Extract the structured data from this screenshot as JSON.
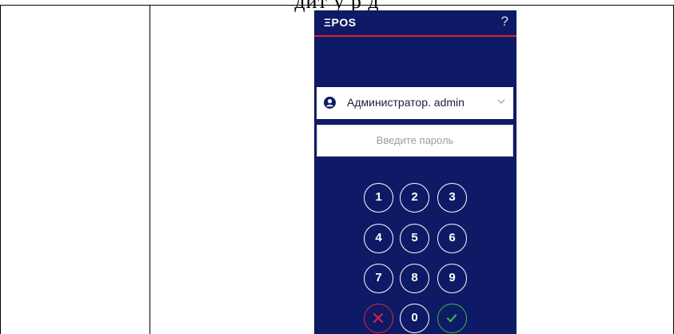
{
  "caption": "дит у   р  д",
  "app": {
    "logo": "ΞPOS",
    "help_label": "?"
  },
  "login": {
    "user_selected": "Администратор. admin",
    "password_placeholder": "Введите пароль"
  },
  "keypad": {
    "keys": [
      "1",
      "2",
      "3",
      "4",
      "5",
      "6",
      "7",
      "8",
      "9",
      "0"
    ],
    "cancel_icon": "close-icon",
    "confirm_icon": "check-icon"
  },
  "colors": {
    "screen_bg": "#0f1a66",
    "accent_red": "#e0202e",
    "cancel": "#d9263a",
    "confirm": "#35b84a"
  }
}
